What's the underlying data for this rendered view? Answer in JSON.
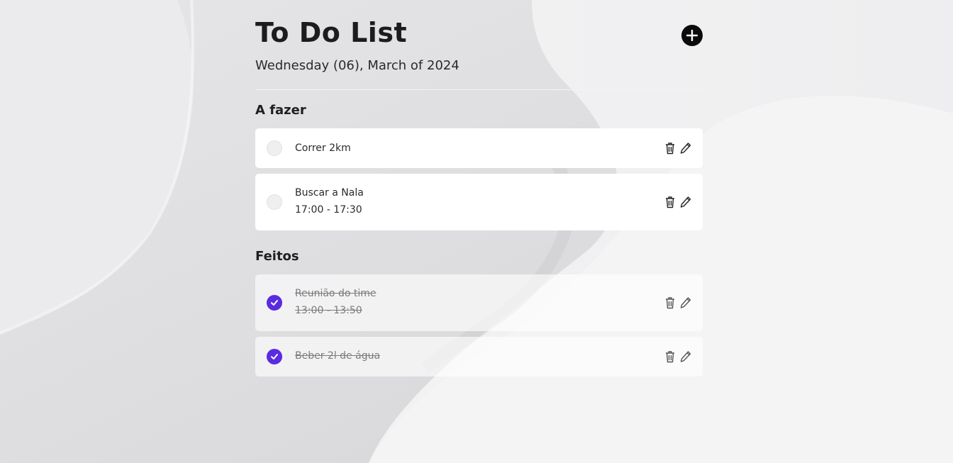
{
  "header": {
    "title": "To Do List",
    "date": "Wednesday (06), March of 2024"
  },
  "sections": {
    "todo": {
      "title": "A fazer",
      "tasks": [
        {
          "name": "Correr 2km",
          "time": ""
        },
        {
          "name": "Buscar a Nala",
          "time": "17:00 - 17:30"
        }
      ]
    },
    "done": {
      "title": "Feitos",
      "tasks": [
        {
          "name": "Reunião do time",
          "time": "13:00 - 13:50"
        },
        {
          "name": "Beber 2l de água",
          "time": ""
        }
      ]
    }
  },
  "icons": {
    "add": "plus-icon",
    "delete": "trash-icon",
    "edit": "pencil-icon",
    "check": "checkmark-icon"
  },
  "colors": {
    "accent": "#5b2be0",
    "add_button": "#0b0b0b",
    "card": "#ffffff"
  }
}
